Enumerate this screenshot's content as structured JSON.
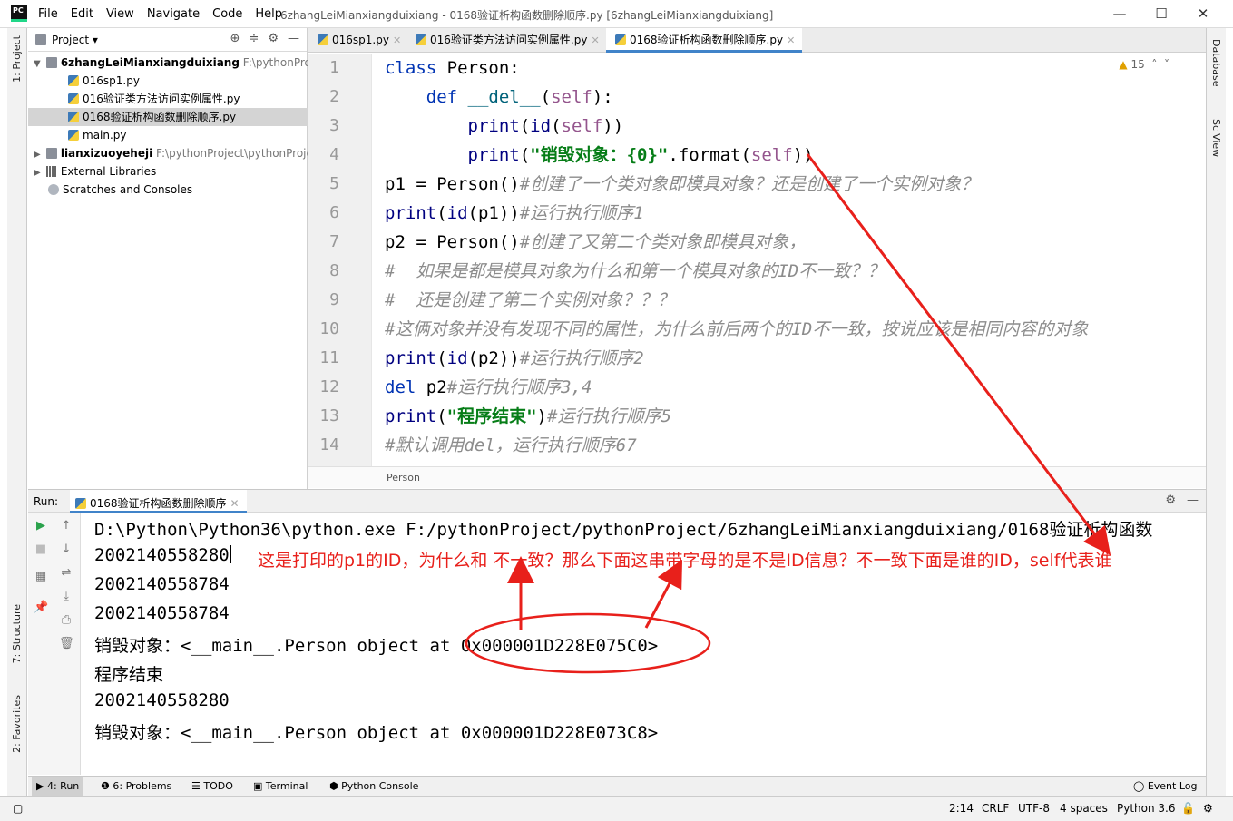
{
  "titlebar": {
    "menu": [
      "File",
      "Edit",
      "View",
      "Navigate",
      "Code",
      "Help"
    ],
    "title": "6zhangLeiMianxiangduixiang - 0168验证析构函数删除顺序.py [6zhangLeiMianxiangduixiang]",
    "minimize": "—",
    "maximize": "☐",
    "close": "✕"
  },
  "left_strip": {
    "project_tab": "1: Project",
    "structure_tab": "7: Structure",
    "favorites_tab": "2: Favorites"
  },
  "right_strip": {
    "database_tab": "Database",
    "sciview_tab": "SciView"
  },
  "project_panel": {
    "title": "Project ▾",
    "items": [
      {
        "label": "6zhangLeiMianxiangduixiang",
        "path": "F:\\pythonProj"
      },
      {
        "label": "016sp1.py"
      },
      {
        "label": "016验证类方法访问实例属性.py"
      },
      {
        "label": "0168验证析构函数删除顺序.py"
      },
      {
        "label": "main.py"
      },
      {
        "label": "lianxizuoyeheji",
        "path": "F:\\pythonProject\\pythonProje"
      },
      {
        "label": "External Libraries"
      },
      {
        "label": "Scratches and Consoles"
      }
    ]
  },
  "editor_tabs": [
    {
      "label": "016sp1.py"
    },
    {
      "label": "016验证类方法访问实例属性.py"
    },
    {
      "label": "0168验证析构函数删除顺序.py"
    }
  ],
  "editor": {
    "warning_count": "15",
    "line_numbers": [
      "1",
      "2",
      "3",
      "4",
      "5",
      "6",
      "7",
      "8",
      "9",
      "10",
      "11",
      "12",
      "13",
      "14"
    ],
    "breadcrumb": "Person",
    "code": {
      "l1_kw": "class",
      "l1_rest": " Person:",
      "l2_kw": "def",
      "l2_fn": "__del__",
      "l2_p1": "(",
      "l2_self": "self",
      "l2_p2": "):",
      "l3_a": "print",
      "l3_b": "(",
      "l3_c": "id",
      "l3_d": "(",
      "l3_self": "self",
      "l3_e": "))",
      "l4_a": "print",
      "l4_b": "(",
      "l4_str": "\"销毁对象：{0}\"",
      "l4_c": ".format(",
      "l4_self": "self",
      "l4_d": "))",
      "l5_code": "p1 = Person()",
      "l5_cm": "#创建了一个类对象即模具对象？还是创建了一个实例对象？",
      "l6_a": "print",
      "l6_b": "(",
      "l6_c": "id",
      "l6_d": "(p1))",
      "l6_cm": "#运行执行顺序1",
      "l7_code": "p2 = Person()",
      "l7_cm": "#创建了又第二个类对象即模具对象，",
      "l8_cm": "#  如果是都是模具对象为什么和第一个模具对象的ID不一致？？",
      "l9_cm": "#  还是创建了第二个实例对象？？？",
      "l10_cm": "#这俩对象并没有发现不同的属性，为什么前后两个的ID不一致，按说应该是相同内容的对象",
      "l11_a": "print",
      "l11_b": "(",
      "l11_c": "id",
      "l11_d": "(p2))",
      "l11_cm": "#运行执行顺序2",
      "l12_kw": "del",
      "l12_rest": " p2",
      "l12_cm": "#运行执行顺序3,4",
      "l13_a": "print",
      "l13_b": "(",
      "l13_str": "\"程序结束\"",
      "l13_c": ")",
      "l13_cm": "#运行执行顺序5",
      "l14_cm": "#默认调用del，运行执行顺序67"
    }
  },
  "run_panel": {
    "label": "Run:",
    "tab": "0168验证析构函数删除顺序",
    "console_lines": [
      "D:\\Python\\Python36\\python.exe F:/pythonProject/pythonProject/6zhangLeiMianxiangduixiang/0168验证析构函数",
      "2002140558280",
      "2002140558784",
      "2002140558784",
      "销毁对象：<__main__.Person object at 0x000001D228E075C0>",
      "程序结束",
      "2002140558280",
      "销毁对象：<__main__.Person object at 0x000001D228E073C8>"
    ],
    "annotation": "这是打印的p1的ID，为什么和 不一致？那么下面这串带字母的是不是ID信息？不一致下面是谁的ID，self代表谁"
  },
  "bottom_tabs": [
    "4: Run",
    "6: Problems",
    "TODO",
    "Terminal",
    "Python Console"
  ],
  "event_log": "Event Log",
  "status_bar": {
    "position": "2:14",
    "line_sep": "CRLF",
    "encoding": "UTF-8",
    "indent": "4 spaces",
    "interpreter": "Python 3.6"
  },
  "colors": {
    "annotation": "#e8201b",
    "keyword": "#0033b3",
    "string": "#067d17",
    "comment": "#8c8c8c",
    "self": "#94558d"
  }
}
